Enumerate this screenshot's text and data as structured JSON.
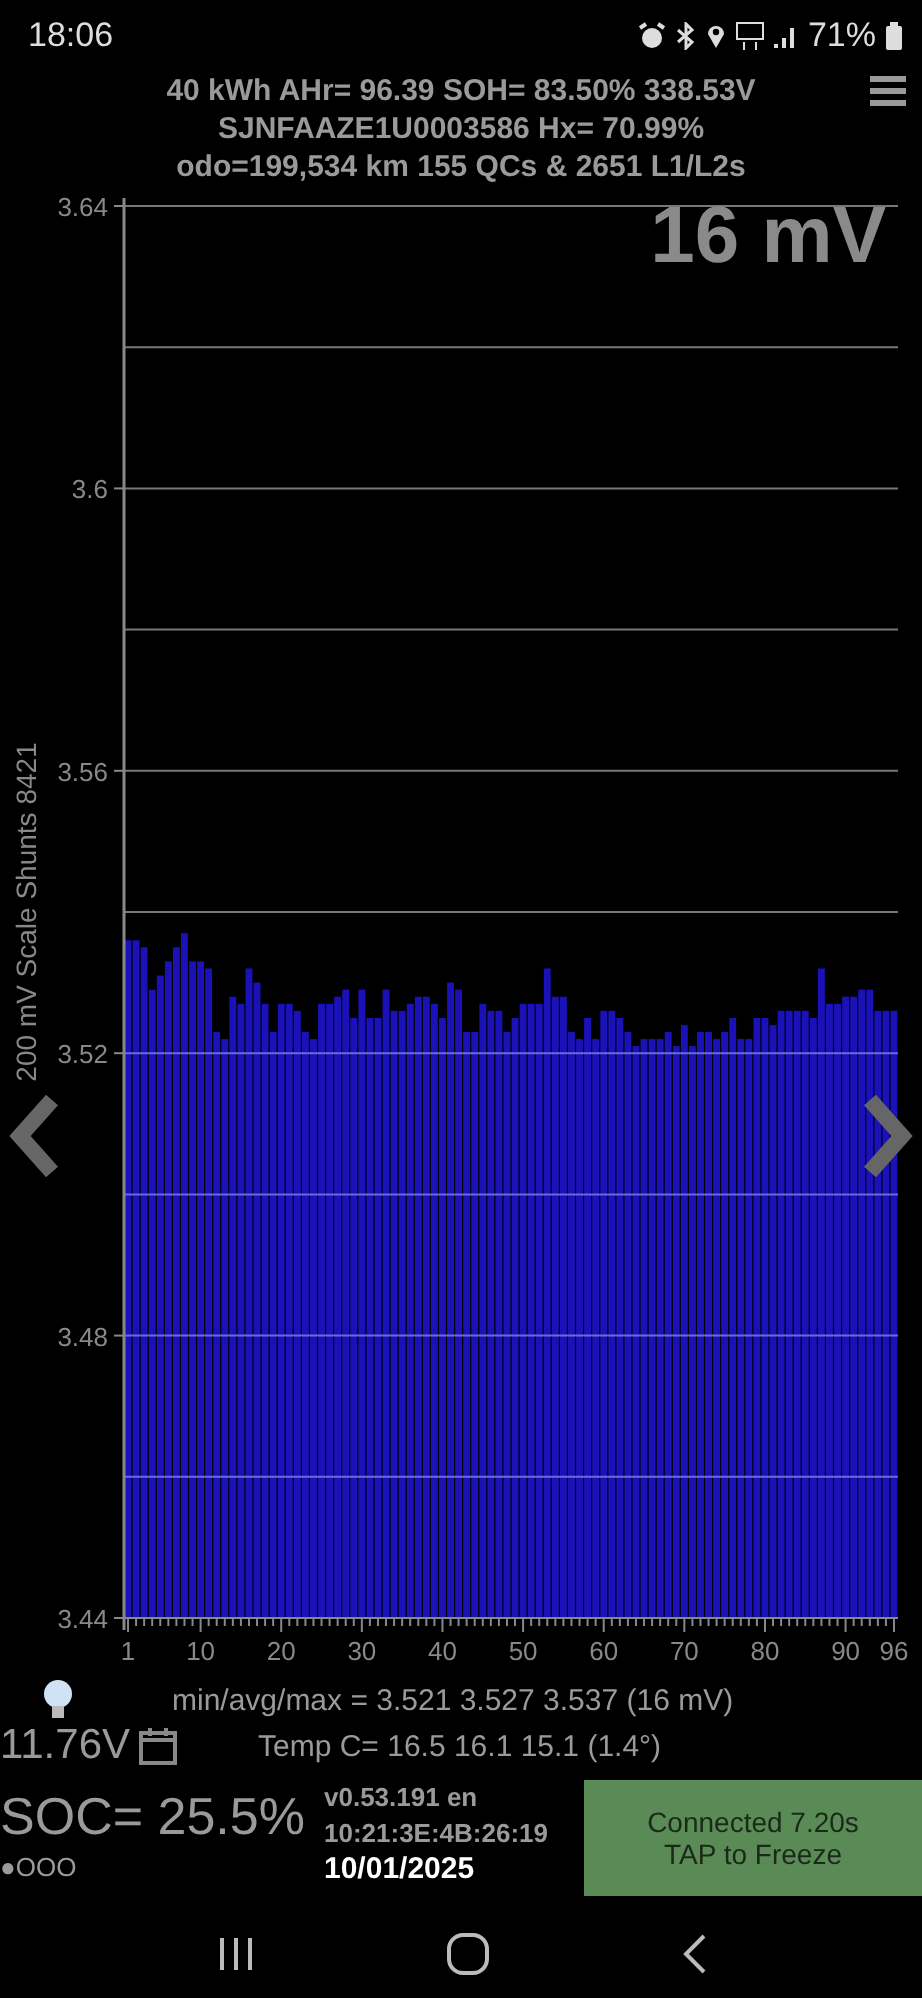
{
  "status_bar": {
    "time": "18:06",
    "battery": "71%"
  },
  "header": {
    "lines": [
      "40 kWh  AHr= 96.39  SOH= 83.50%   338.53V",
      "SJNFAAZE1U0003586   Hx= 70.99%",
      "odo=199,534 km 155 QCs & 2651 L1/L2s"
    ]
  },
  "spread_reading": "16 mV",
  "chart": {
    "chart_data": {
      "type": "bar",
      "ylabel": "200 mV Scale Shunts 8421",
      "ylim": [
        3.44,
        3.64
      ],
      "yticks": [
        3.44,
        3.48,
        3.52,
        3.56,
        3.6,
        {
          "value": 3.64,
          "label": "3.64"
        }
      ],
      "xlim": [
        0.5,
        96.5
      ],
      "xticks": [
        1,
        10,
        20,
        30,
        40,
        50,
        60,
        70,
        80,
        90,
        96
      ],
      "grid": true,
      "x": [
        1,
        2,
        3,
        4,
        5,
        6,
        7,
        8,
        9,
        10,
        11,
        12,
        13,
        14,
        15,
        16,
        17,
        18,
        19,
        20,
        21,
        22,
        23,
        24,
        25,
        26,
        27,
        28,
        29,
        30,
        31,
        32,
        33,
        34,
        35,
        36,
        37,
        38,
        39,
        40,
        41,
        42,
        43,
        44,
        45,
        46,
        47,
        48,
        49,
        50,
        51,
        52,
        53,
        54,
        55,
        56,
        57,
        58,
        59,
        60,
        61,
        62,
        63,
        64,
        65,
        66,
        67,
        68,
        69,
        70,
        71,
        72,
        73,
        74,
        75,
        76,
        77,
        78,
        79,
        80,
        81,
        82,
        83,
        84,
        85,
        86,
        87,
        88,
        89,
        90,
        91,
        92,
        93,
        94,
        95,
        96
      ],
      "series": [
        {
          "color": "#1a12b8",
          "values": [
            3.536,
            3.536,
            3.535,
            3.529,
            3.531,
            3.533,
            3.535,
            3.537,
            3.533,
            3.533,
            3.532,
            3.523,
            3.522,
            3.528,
            3.527,
            3.532,
            3.53,
            3.527,
            3.523,
            3.527,
            3.527,
            3.526,
            3.523,
            3.522,
            3.527,
            3.527,
            3.528,
            3.529,
            3.525,
            3.529,
            3.525,
            3.525,
            3.529,
            3.526,
            3.526,
            3.527,
            3.528,
            3.528,
            3.527,
            3.525,
            3.53,
            3.529,
            3.523,
            3.523,
            3.527,
            3.526,
            3.526,
            3.523,
            3.525,
            3.527,
            3.527,
            3.527,
            3.532,
            3.528,
            3.528,
            3.523,
            3.522,
            3.525,
            3.522,
            3.526,
            3.526,
            3.525,
            3.523,
            3.521,
            3.522,
            3.522,
            3.522,
            3.523,
            3.521,
            3.524,
            3.521,
            3.523,
            3.523,
            3.522,
            3.523,
            3.525,
            3.522,
            3.522,
            3.525,
            3.525,
            3.524,
            3.526,
            3.526,
            3.526,
            3.526,
            3.525,
            3.532,
            3.527,
            3.527,
            3.528,
            3.528,
            3.529,
            3.529,
            3.526,
            3.526,
            3.526
          ]
        }
      ]
    }
  },
  "stats": "min/avg/max = 3.521 3.527 3.537  (16 mV)",
  "aux_voltage": "11.76V",
  "temps": "Temp C= 16.5  16.1  15.1  (1.4°)",
  "soc": "SOC= 25.5%",
  "indicator": "●OOO",
  "version": "v0.53.191 en",
  "device_id": "10:21:3E:4B:26:19",
  "date": "10/01/2025",
  "connect_button": {
    "lines": [
      "Connected 7.20s",
      "TAP to Freeze"
    ]
  }
}
